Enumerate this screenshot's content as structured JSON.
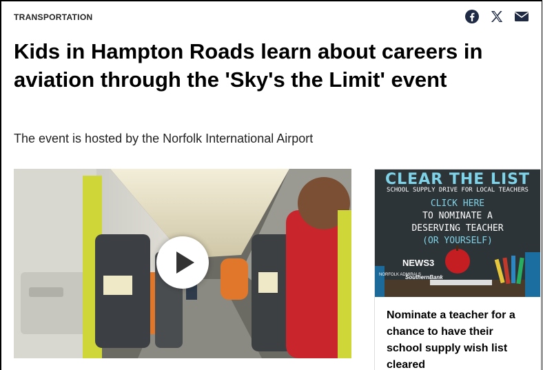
{
  "category": "TRANSPORTATION",
  "share": {
    "icons": [
      "facebook-icon",
      "x-icon",
      "email-icon"
    ]
  },
  "headline": "Kids in Hampton Roads learn about careers in aviation through the 'Sky's the Limit' event",
  "subtitle": "The event is hosted by the Norfolk International Airport",
  "video": {
    "play_icon": "play-icon"
  },
  "promo": {
    "image": {
      "line1": "CLEAR THE LIST",
      "line2": "SCHOOL SUPPLY DRIVE FOR LOCAL TEACHERS",
      "line3": "CLICK HERE",
      "line4": "TO NOMINATE A",
      "line5": "DESERVING TEACHER",
      "line6": "(OR YOURSELF)",
      "logo1": "NEWS3",
      "logo2": "NORFOLK ADMIRALS",
      "logo3": "SouthernBank"
    },
    "title": "Nominate a teacher for a chance to have their school supply wish list cleared"
  },
  "colors": {
    "accent_cyan": "#7fd3e8",
    "icon": "#1f2a44"
  }
}
